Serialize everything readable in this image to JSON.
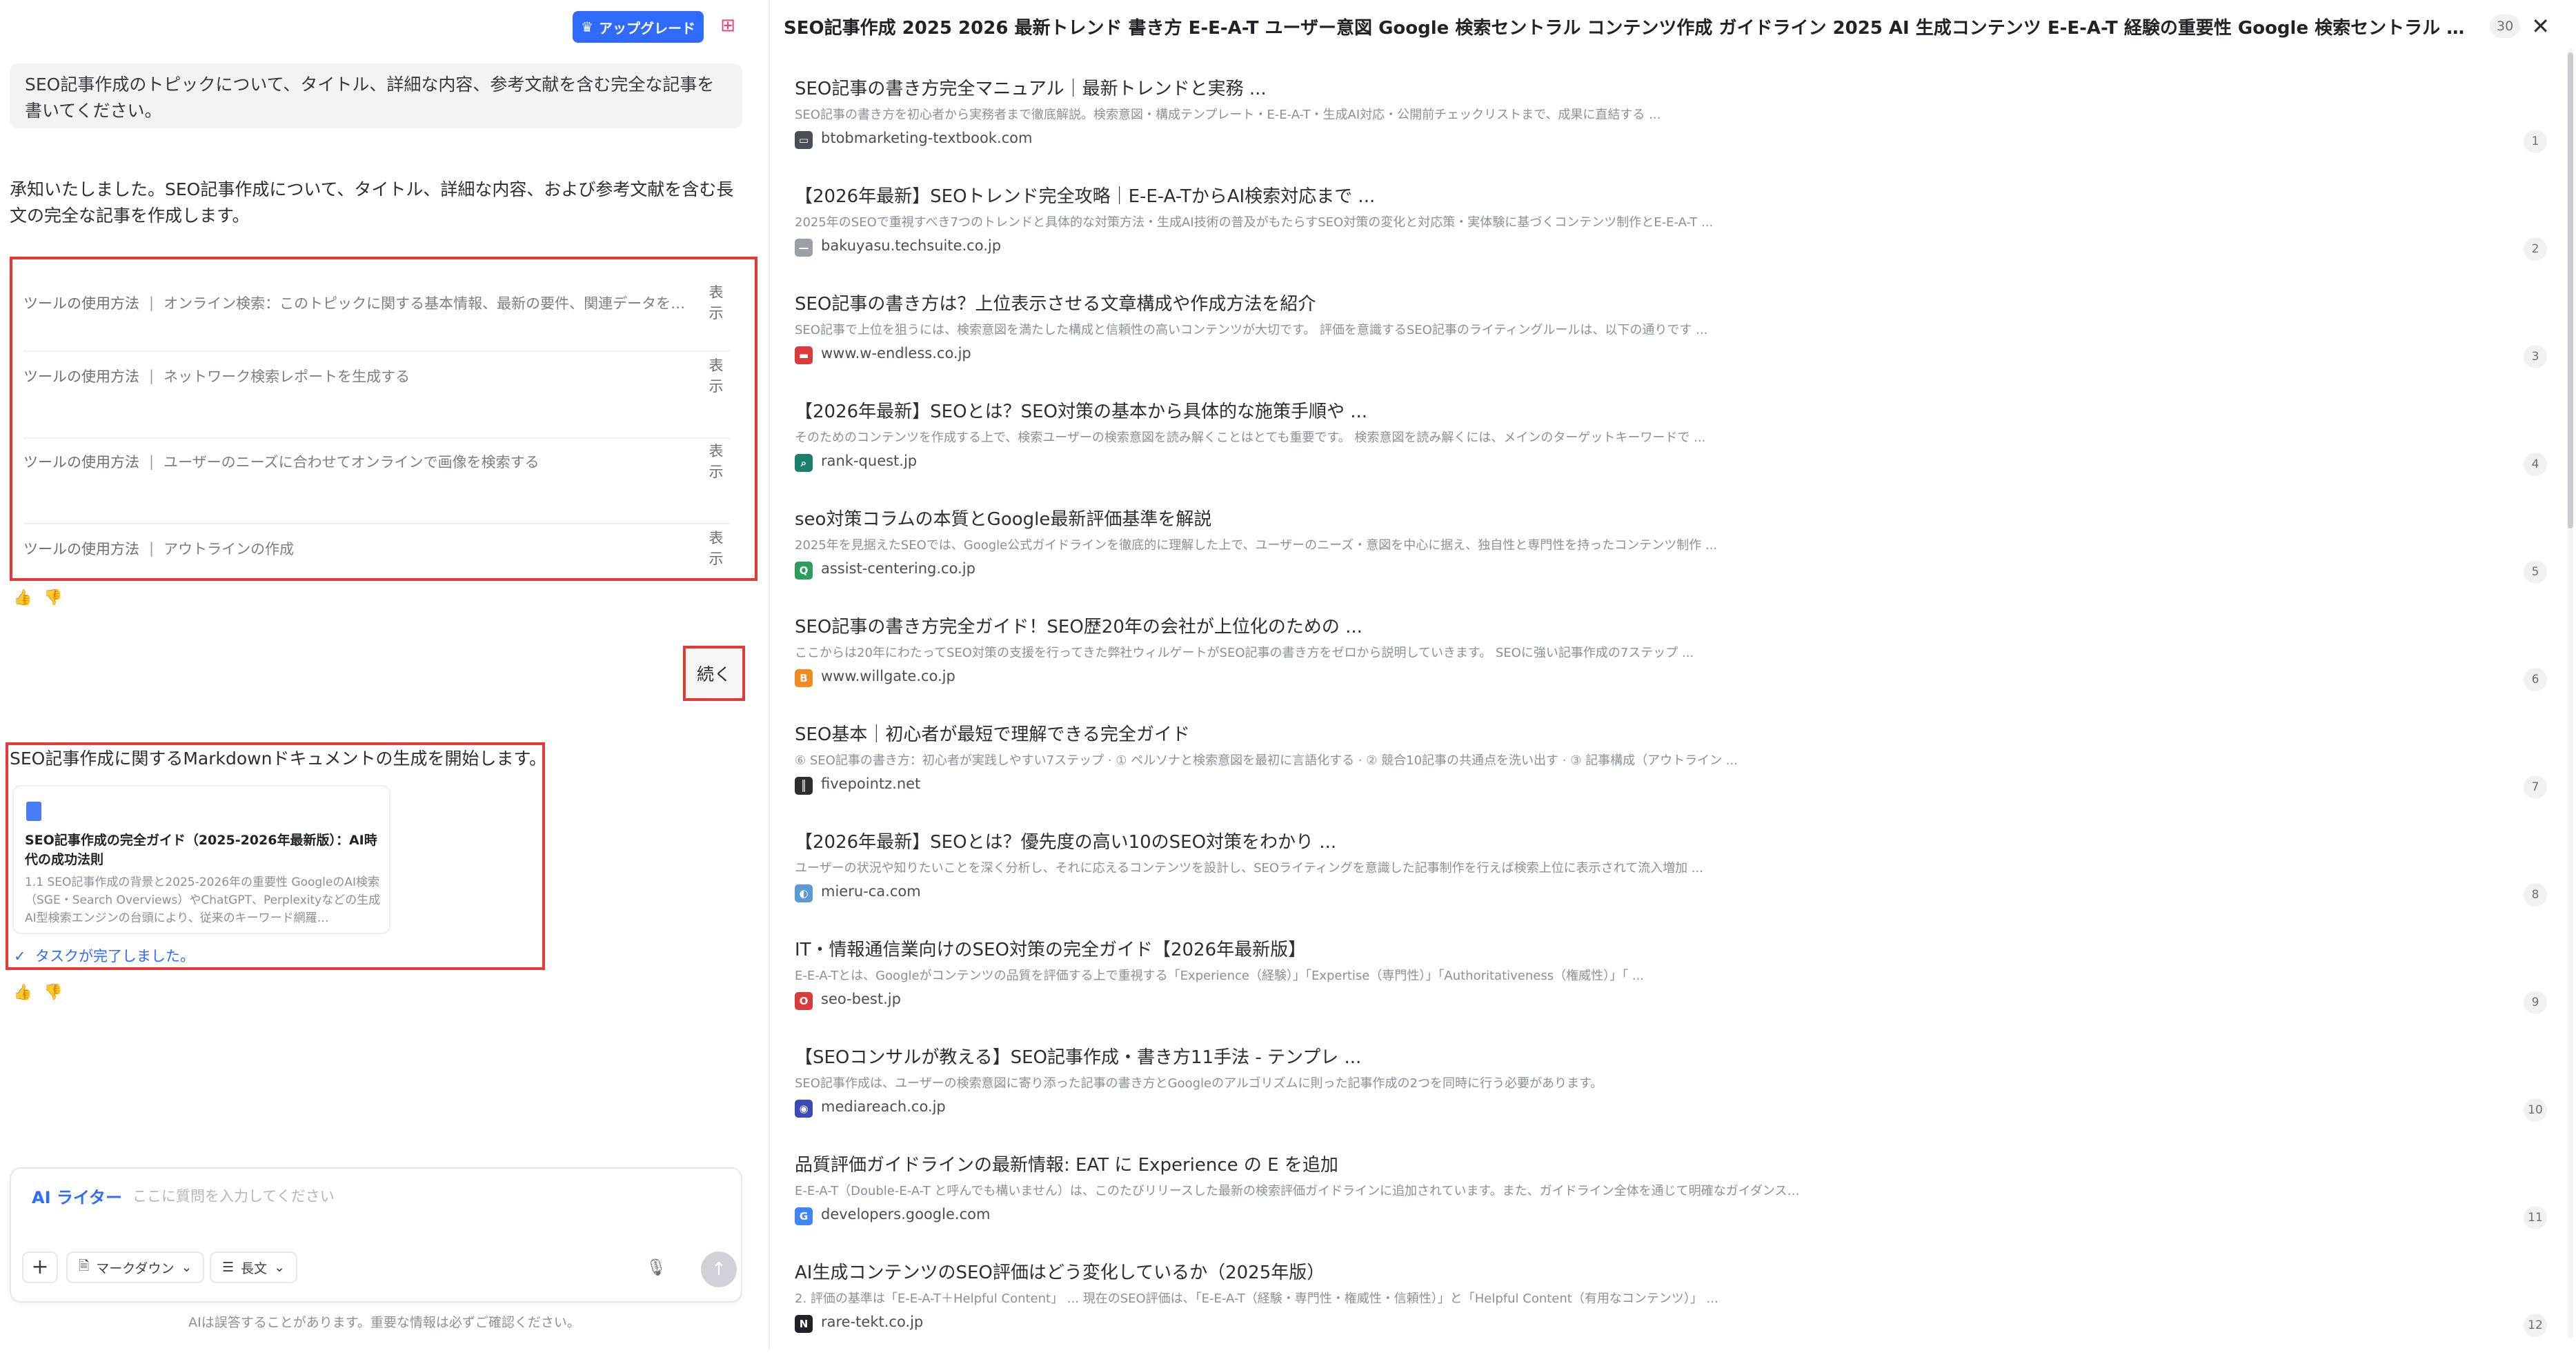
{
  "toolbar": {
    "upgrade_label": "アップグレード",
    "upgrade_icon": "crown-icon",
    "gift_icon": "gift-icon"
  },
  "chat": {
    "user_message": "SEO記事作成のトピックについて、タイトル、詳細な内容、参考文献を含む完全な記事を書いてください。",
    "assistant_reply": "承知いたしました。SEO記事作成について、タイトル、詳細な内容、および参考文献を含む長文の完全な記事を作成します。",
    "tool_steps": [
      {
        "label": "ツールの使用方法",
        "detail": "オンライン検索：このトピックに関する基本情報、最新の要件、関連データを…",
        "action": "表示"
      },
      {
        "label": "ツールの使用方法",
        "detail": "ネットワーク検索レポートを生成する",
        "action": "表示"
      },
      {
        "label": "ツールの使用方法",
        "detail": "ユーザーのニーズに合わせてオンラインで画像を検索する",
        "action": "表示"
      },
      {
        "label": "ツールの使用方法",
        "detail": "アウトラインの作成",
        "action": "表示"
      }
    ],
    "continue_label": "続く",
    "doc_intro": "SEO記事作成に関するMarkdownドキュメントの生成を開始します。",
    "doc_card": {
      "title": "SEO記事作成の完全ガイド（2025-2026年最新版）：AI時代の成功法則",
      "body": "1.1 SEO記事作成の背景と2025-2026年の重要性 GoogleのAI検索（SGE・Search Overviews）やChatGPT、Perplexityなどの生成AI型検索エンジンの台頭により、従来のキーワード網羅…"
    },
    "task_done": "タスクが完了しました。"
  },
  "composer": {
    "mode_label": "AI ライター",
    "placeholder": "ここに質問を入力してください",
    "format_chip": "マークダウン",
    "length_chip": "長文",
    "disclaimer": "AIは誤答することがあります。重要な情報は必ずご確認ください。"
  },
  "sources_panel": {
    "title": "SEO記事作成 2025 2026 最新トレンド 書き方 E-E-A-T ユーザー意図 Google 検索セントラル コンテンツ作成 ガイドライン 2025 AI 生成コンテンツ E-E-A-T 経験の重要性 Google 検索セントラル コンテンツ作成 質の高い …",
    "count": "30",
    "items": [
      {
        "title": "SEO記事の書き方完全マニュアル｜最新トレンドと実務 ...",
        "snippet": "SEO記事の書き方を初心者から実務者まで徹底解説。検索意図・構成テンプレート・E-E-A-T・生成AI対応・公開前チェックリストまで、成果に直結する ...",
        "domain": "btobmarketing-textbook.com",
        "num": "1",
        "fav_color": "#4a4f55",
        "fav_icon": "book-icon"
      },
      {
        "title": "【2026年最新】SEOトレンド完全攻略｜E-E-A-TからAI検索対応まで ...",
        "snippet": "2025年のSEOで重視すべき7つのトレンドと具体的な対策方法・生成AI技術の普及がもたらすSEO対策の変化と対応策・実体験に基づくコンテンツ制作とE-E-A-T ...",
        "domain": "bakuyasu.techsuite.co.jp",
        "num": "2",
        "fav_color": "#9aa0a6",
        "fav_icon": "dash-icon"
      },
      {
        "title": "SEO記事の書き方は？上位表示させる文章構成や作成方法を紹介",
        "snippet": "SEO記事で上位を狙うには、検索意図を満たした構成と信頼性の高いコンテンツが大切です。 評価を意識するSEO記事のライティングルールは、以下の通りです ...",
        "domain": "www.w-endless.co.jp",
        "num": "3",
        "fav_color": "#d93b3b",
        "fav_icon": "laptop-icon"
      },
      {
        "title": "【2026年最新】SEOとは？SEO対策の基本から具体的な施策手順や ...",
        "snippet": "そのためのコンテンツを作成する上で、検索ユーザーの検索意図を読み解くことはとても重要です。 検索意図を読み解くには、メインのターゲットキーワードで ...",
        "domain": "rank-quest.jp",
        "num": "4",
        "fav_color": "#1b7f6b",
        "fav_icon": "search-icon"
      },
      {
        "title": "seo対策コラムの本質とGoogle最新評価基準を解説",
        "snippet": "2025年を見据えたSEOでは、Google公式ガイドラインを徹底的に理解した上で、ユーザーのニーズ・意図を中心に据え、独自性と専門性を持ったコンテンツ制作 ...",
        "domain": "assist-centering.co.jp",
        "num": "5",
        "fav_color": "#2e9d5b",
        "fav_icon": "q-logo-icon"
      },
      {
        "title": "SEO記事の書き方完全ガイド！SEO歴20年の会社が上位化のための ...",
        "snippet": "ここからは20年にわたってSEO対策の支援を行ってきた弊社ウィルゲートがSEO記事の書き方をゼロから説明していきます。 SEOに強い記事作成の7ステップ ...",
        "domain": "www.willgate.co.jp",
        "num": "6",
        "fav_color": "#f08a24",
        "fav_icon": "shield-icon"
      },
      {
        "title": "SEO基本｜初心者が最短で理解できる完全ガイド",
        "snippet": "⑥ SEO記事の書き方：初心者が実践しやすい7ステップ · ① ペルソナと検索意図を最初に言語化する · ② 競合10記事の共通点を洗い出す · ③ 記事構成（アウトライン ...",
        "domain": "fivepointz.net",
        "num": "7",
        "fav_color": "#2b2f33",
        "fav_icon": "bars-icon"
      },
      {
        "title": "【2026年最新】SEOとは？優先度の高い10のSEO対策をわかり ...",
        "snippet": "ユーザーの状況や知りたいことを深く分析し、それに応えるコンテンツを設計し、SEOライティングを意識した記事制作を行えば検索上位に表示されて流入増加 ...",
        "domain": "mieru-ca.com",
        "num": "8",
        "fav_color": "#5b9bd5",
        "fav_icon": "globe-icon"
      },
      {
        "title": "IT・情報通信業向けのSEO対策の完全ガイド【2026年最新版】",
        "snippet": "E-E-A-Tとは、Googleがコンテンツの品質を評価する上で重視する「Experience（経験）」「Expertise（専門性）」「Authoritativeness（権威性）」「 ...",
        "domain": "seo-best.jp",
        "num": "9",
        "fav_color": "#d93b3b",
        "fav_icon": "circle-icon"
      },
      {
        "title": "【SEOコンサルが教える】SEO記事作成・書き方11手法 - テンプレ ...",
        "snippet": "SEO記事作成は、ユーザーの検索意図に寄り添った記事の書き方とGoogleのアルゴリズムに則った記事作成の2つを同時に行う必要があります。",
        "domain": "mediareach.co.jp",
        "num": "10",
        "fav_color": "#3b4bb5",
        "fav_icon": "eye-icon"
      },
      {
        "title": "品質評価ガイドラインの最新情報: EAT に Experience の E を追加",
        "snippet": "E-E-A-T（Double-E-A-T と呼んでも構いません）は、このたびリリースした最新の検索評価ガイドラインに追加されています。また、ガイドライン全体を通じて明確なガイダンスを ...",
        "domain": "developers.google.com",
        "num": "11",
        "fav_color": "#4285f4",
        "fav_icon": "google-icon"
      },
      {
        "title": "AI生成コンテンツのSEO評価はどう変化しているか（2025年版）",
        "snippet": "2. 評価の基準は「E-E-A-T＋Helpful Content」 ... 現在のSEO評価は、「E-E-A-T（経験・専門性・権威性・信頼性）」と「Helpful Content（有用なコンテンツ）」 ...",
        "domain": "rare-tekt.co.jp",
        "num": "12",
        "fav_color": "#1f2328",
        "fav_icon": "n-logo-icon"
      }
    ]
  }
}
